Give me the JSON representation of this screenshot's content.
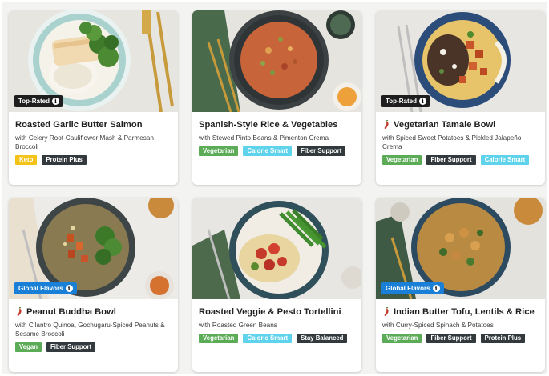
{
  "colors": {
    "tag_dark": "#1e1e1e",
    "tag_blue": "#1a7fd6",
    "badge_green": "#5cab57",
    "badge_dark": "#333a3d",
    "badge_blue": "#5fd2ec",
    "badge_yellow": "#f3c317",
    "spicy_icon": "#c0392b"
  },
  "recipes": [
    {
      "title": "Roasted Garlic Butter Salmon",
      "subtitle": "with Celery Root-Cauliflower Mash & Parmesan Broccoli",
      "tag": "Top-Rated",
      "badges": [
        "Keto",
        "Protein Plus"
      ]
    },
    {
      "title": "Spanish-Style Rice & Vegetables",
      "subtitle": "with Stewed Pinto Beans & Pimenton Crema",
      "badges": [
        "Vegetarian",
        "Calorie Smart",
        "Fiber Support"
      ]
    },
    {
      "title": "Vegetarian Tamale Bowl",
      "subtitle": "with Spiced Sweet Potatoes & Pickled Jalapeño Crema",
      "tag": "Top-Rated",
      "spicy_icon": "chili-pepper-icon",
      "badges": [
        "Vegetarian",
        "Fiber Support",
        "Calorie Smart"
      ]
    },
    {
      "title": "Peanut Buddha Bowl",
      "subtitle": "with Cilantro Quinoa, Gochugaru-Spiced Peanuts & Sesame Broccoli",
      "tag": "Global Flavors",
      "spicy_icon": "chili-pepper-icon",
      "badges": [
        "Vegan",
        "Fiber Support"
      ]
    },
    {
      "title": "Roasted Veggie & Pesto Tortellini",
      "subtitle": "with Roasted Green Beans",
      "badges": [
        "Vegetarian",
        "Calorie Smart",
        "Stay Balanced"
      ]
    },
    {
      "title": "Indian Butter Tofu, Lentils & Rice",
      "subtitle": "with Curry-Spiced Spinach & Potatoes",
      "tag": "Global Flavors",
      "spicy_icon": "chili-pepper-icon",
      "badges": [
        "Vegetarian",
        "Fiber Support",
        "Protein Plus"
      ]
    }
  ]
}
